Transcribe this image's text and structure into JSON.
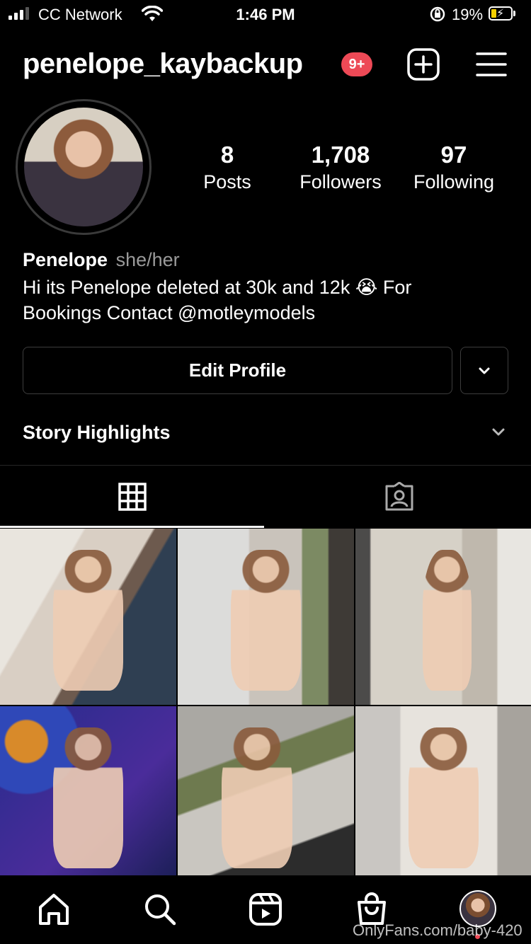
{
  "status_bar": {
    "carrier": "CC Network",
    "time": "1:46 PM",
    "battery_percent": "19%"
  },
  "header": {
    "username": "penelope_kaybackup",
    "notification_badge": "9+",
    "new_post_icon": "plus-square-icon",
    "menu_icon": "hamburger-menu-icon"
  },
  "profile": {
    "stats": [
      {
        "value": "8",
        "label": "Posts"
      },
      {
        "value": "1,708",
        "label": "Followers"
      },
      {
        "value": "97",
        "label": "Following"
      }
    ],
    "name": "Penelope",
    "pronouns": "she/her",
    "bio_line1": "Hi its Penelope deleted at 30k and 12k 😭 For",
    "bio_line2": "Bookings Contact @motleymodels",
    "edit_profile_label": "Edit Profile"
  },
  "story_highlights": {
    "label": "Story Highlights"
  },
  "tabs": [
    {
      "icon": "grid-icon",
      "active": true
    },
    {
      "icon": "tagged-person-icon",
      "active": false
    }
  ],
  "posts": [
    {
      "thumb": "photo-1"
    },
    {
      "thumb": "photo-2"
    },
    {
      "thumb": "photo-3"
    },
    {
      "thumb": "photo-4"
    },
    {
      "thumb": "photo-5"
    },
    {
      "thumb": "photo-6"
    }
  ],
  "bottom_nav": [
    {
      "icon": "home-icon"
    },
    {
      "icon": "search-icon"
    },
    {
      "icon": "reels-icon"
    },
    {
      "icon": "shop-icon"
    },
    {
      "icon": "profile-avatar"
    }
  ],
  "watermark": "OnlyFans.com/baby-420",
  "colors": {
    "background": "#000000",
    "badge": "#ed4956",
    "border": "#3d3d3d",
    "secondary_text": "#9a9a9a"
  }
}
